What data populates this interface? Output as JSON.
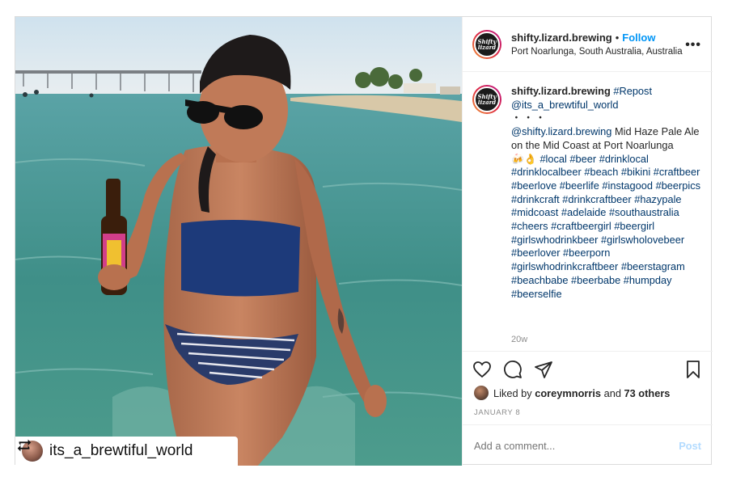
{
  "photo": {
    "repost_name": "its_a_brewtiful_world"
  },
  "header": {
    "username": "shifty.lizard.brewing",
    "separator": "•",
    "follow_label": "Follow",
    "location": "Port Noarlunga, South Australia, Australia",
    "more_label": "•••"
  },
  "caption": {
    "username": "shifty.lizard.brewing",
    "repost_tag": "#Repost",
    "repost_handle": "@its_a_brewtiful_world",
    "dots": "・・・",
    "mention": "@shifty.lizard.brewing",
    "body": "Mid Haze Pale Ale on the Mid Coast at Port Noarlunga",
    "emoji": "🍻👌",
    "hashtags": "#local #beer #drinklocal #drinklocalbeer #beach #bikini #craftbeer #beerlove #beerlife #instagood #beerpics #drinkcraft #drinkcraftbeer #hazypale #midcoast #adelaide #southaustralia #cheers #craftbeergirl #beergirl #girlswhodrinkbeer #girlswholovebeer #beerlover #beerporn #girlswhodrinkcraftbeer #beerstagram #beachbabe #beerbabe #humpday #beerselfie",
    "age": "20w"
  },
  "actions": {
    "liked_prefix": "Liked by",
    "liked_user": "coreymnorris",
    "liked_and": "and",
    "liked_others": "73 others",
    "date": "JANUARY 8",
    "comment_placeholder": "Add a comment...",
    "post_label": "Post"
  },
  "colors": {
    "accent": "#0095f6",
    "tag": "#00376b",
    "muted": "#8e8e8e",
    "post_disabled": "#b3dbff"
  }
}
